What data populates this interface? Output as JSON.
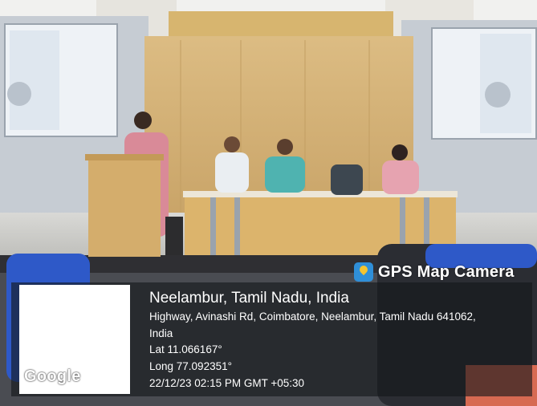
{
  "overlay": {
    "badge_text": "GPS Map Camera",
    "location_title": "Neelambur, Tamil Nadu, India",
    "address_line1": "Highway, Avinashi Rd, Coimbatore, Neelambur, Tamil Nadu 641062,",
    "address_line2": "India",
    "latitude": "Lat 11.066167°",
    "longitude": "Long 77.092351°",
    "datetime": "22/12/23 02:15 PM GMT +05:30",
    "map_logo": "Google"
  },
  "colors": {
    "wood_panel": "#d9b57a",
    "wall": "#c9cfd6",
    "floor": "#cfcfcc",
    "chair_blue": "#2e59c8",
    "overlay_bg": "#14161a"
  },
  "icons": {
    "badge_icon": "map-pin-icon"
  }
}
